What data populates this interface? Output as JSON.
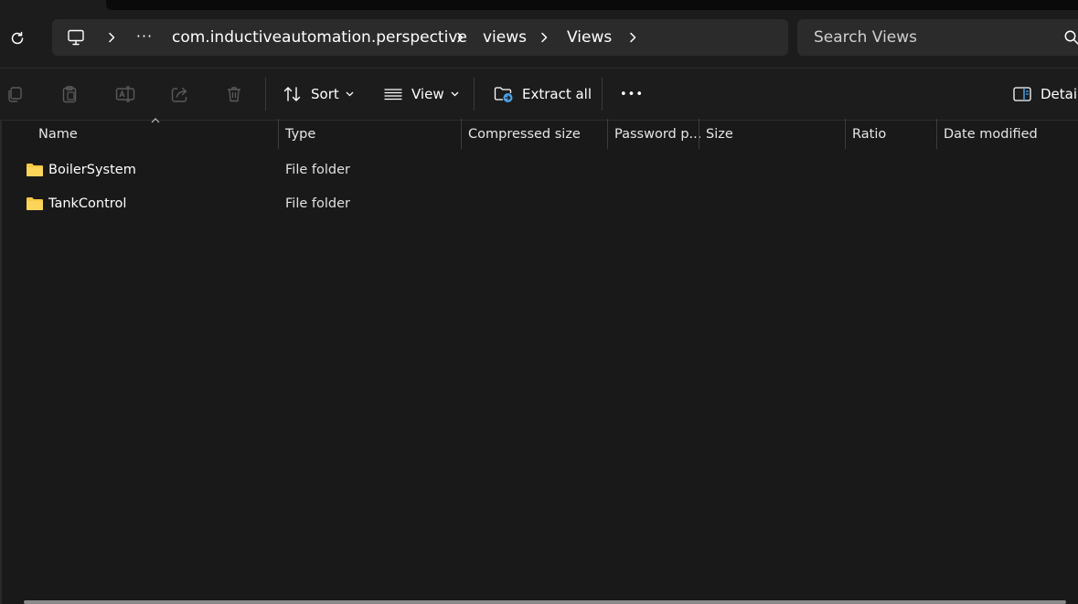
{
  "address_bar": {
    "ellipsis": "···",
    "crumbs": [
      "com.inductiveautomation.perspective",
      "views",
      "Views"
    ]
  },
  "search": {
    "placeholder": "Search Views"
  },
  "toolbar": {
    "sort_label": "Sort",
    "view_label": "View",
    "extract_label": "Extract all",
    "more_label": "•••",
    "details_label": "Details"
  },
  "columns": [
    "Name",
    "Type",
    "Compressed size",
    "Password p...",
    "Size",
    "Ratio",
    "Date modified"
  ],
  "files": [
    {
      "name": "BoilerSystem",
      "type": "File folder"
    },
    {
      "name": "TankControl",
      "type": "File folder"
    }
  ],
  "colors": {
    "background": "#191919",
    "folder": "#f8c942",
    "accent": "#4ba3e8"
  }
}
